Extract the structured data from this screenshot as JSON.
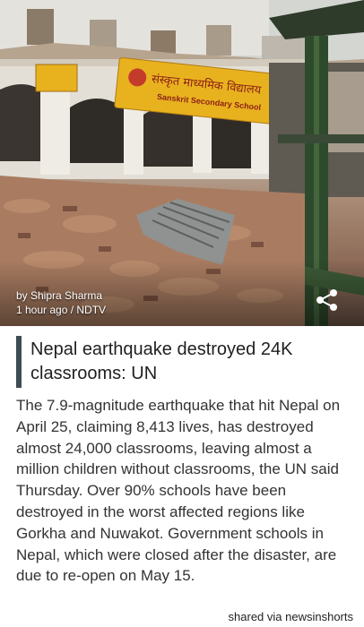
{
  "article": {
    "byline_author": "by Shipra Sharma",
    "byline_meta": "1 hour ago / NDTV",
    "headline": "Nepal earthquake destroyed 24K classrooms: UN",
    "body": "The 7.9-magnitude earthquake that hit Nepal on April 25, claiming 8,413 lives, has destroyed almost 24,000 classrooms, leaving almost a million children without classrooms, the UN said Thursday. Over 90% schools have been destroyed in the worst affected regions like Gorkha and Nuwakot. Government schools in Nepal, which were closed after the disaster, are due to re-open on May 15."
  },
  "hero": {
    "sign_small": "",
    "sign_main": "संस्कृत माध्यमिक विद्यालय",
    "sign_sub": "Sanskrit Secondary School"
  },
  "footer": {
    "shared_via": "shared via newsinshorts"
  },
  "icons": {
    "share": "share-icon"
  },
  "colors": {
    "headline_bar": "#3d4b54",
    "sign_yellow": "#e8b21f"
  }
}
